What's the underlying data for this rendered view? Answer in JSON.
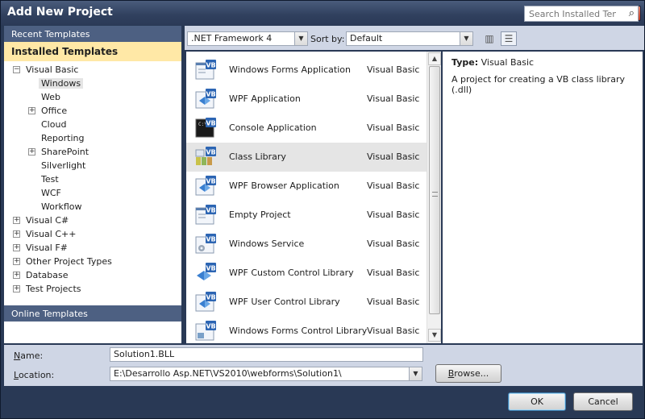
{
  "window": {
    "title": "Add New Project"
  },
  "sidebar": {
    "recent": "Recent Templates",
    "installed": "Installed Templates",
    "online": "Online Templates",
    "tree": [
      {
        "label": "Visual Basic",
        "level": 0,
        "expander": "-"
      },
      {
        "label": "Windows",
        "level": 1,
        "expander": "",
        "selected": true
      },
      {
        "label": "Web",
        "level": 1,
        "expander": ""
      },
      {
        "label": "Office",
        "level": 1,
        "expander": "+"
      },
      {
        "label": "Cloud",
        "level": 1,
        "expander": ""
      },
      {
        "label": "Reporting",
        "level": 1,
        "expander": ""
      },
      {
        "label": "SharePoint",
        "level": 1,
        "expander": "+"
      },
      {
        "label": "Silverlight",
        "level": 1,
        "expander": ""
      },
      {
        "label": "Test",
        "level": 1,
        "expander": ""
      },
      {
        "label": "WCF",
        "level": 1,
        "expander": ""
      },
      {
        "label": "Workflow",
        "level": 1,
        "expander": ""
      },
      {
        "label": "Visual C#",
        "level": 0,
        "expander": "+"
      },
      {
        "label": "Visual C++",
        "level": 0,
        "expander": "+"
      },
      {
        "label": "Visual F#",
        "level": 0,
        "expander": "+"
      },
      {
        "label": "Other Project Types",
        "level": 0,
        "expander": "+"
      },
      {
        "label": "Database",
        "level": 0,
        "expander": "+"
      },
      {
        "label": "Test Projects",
        "level": 0,
        "expander": "+"
      }
    ]
  },
  "toolbar": {
    "framework": ".NET Framework 4",
    "sort_label": "Sort by:",
    "sort_value": "Default",
    "search_placeholder": "Search Installed Templa"
  },
  "templates": [
    {
      "name": "Windows Forms Application",
      "lang": "Visual Basic",
      "icon": "windows-forms-icon"
    },
    {
      "name": "WPF Application",
      "lang": "Visual Basic",
      "icon": "wpf-icon"
    },
    {
      "name": "Console Application",
      "lang": "Visual Basic",
      "icon": "console-icon"
    },
    {
      "name": "Class Library",
      "lang": "Visual Basic",
      "icon": "class-library-icon",
      "selected": true
    },
    {
      "name": "WPF Browser Application",
      "lang": "Visual Basic",
      "icon": "wpf-browser-icon"
    },
    {
      "name": "Empty Project",
      "lang": "Visual Basic",
      "icon": "empty-project-icon"
    },
    {
      "name": "Windows Service",
      "lang": "Visual Basic",
      "icon": "windows-service-icon"
    },
    {
      "name": "WPF Custom Control Library",
      "lang": "Visual Basic",
      "icon": "wpf-custom-control-icon"
    },
    {
      "name": "WPF User Control Library",
      "lang": "Visual Basic",
      "icon": "wpf-user-control-icon"
    },
    {
      "name": "Windows Forms Control Library",
      "lang": "Visual Basic",
      "icon": "forms-control-icon"
    }
  ],
  "details": {
    "type_label": "Type:",
    "type_value": "Visual Basic",
    "description": "A project for creating a VB class library (.dll)"
  },
  "form": {
    "name_label": "ame:",
    "name_key": "N",
    "name_value": "Solution1.BLL",
    "location_label": "ocation:",
    "location_key": "L",
    "location_value": "E:\\Desarrollo Asp.NET\\VS2010\\webforms\\Solution1\\",
    "browse_label": "rowse...",
    "browse_key": "B"
  },
  "buttons": {
    "ok": "OK",
    "cancel": "Cancel"
  }
}
